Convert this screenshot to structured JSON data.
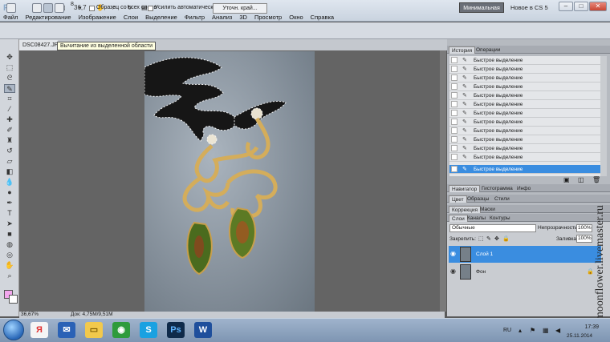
{
  "app": {
    "logo": "Ps",
    "zoom": "36,7",
    "workspace": "Минимальная",
    "whats_new": "Новое в CS 5",
    "window_buttons": [
      "–",
      "□",
      "✕"
    ]
  },
  "menu": [
    "Файл",
    "Редактирование",
    "Изображение",
    "Слои",
    "Выделение",
    "Фильтр",
    "Анализ",
    "3D",
    "Просмотр",
    "Окно",
    "Справка"
  ],
  "options": {
    "brush_size": "8",
    "sample_all_layers": "Образец со всех слоев",
    "auto_enhance": "Усилить автоматически",
    "refine_edge": "Уточн. край..."
  },
  "document": {
    "tab_name": "DSC08427.JPG",
    "tooltip": "Вычитание из выделенной области",
    "zoom_status": "36,67%",
    "doc_status": "Док: 4,75M/9,51M"
  },
  "panels": {
    "history_tabs": [
      "История",
      "Операции"
    ],
    "history_items": [
      "Быстрое выделение",
      "Быстрое выделение",
      "Быстрое выделение",
      "Быстрое выделение",
      "Быстрое выделение",
      "Быстрое выделение",
      "Быстрое выделение",
      "Быстрое выделение",
      "Быстрое выделение",
      "Быстрое выделение",
      "Быстрое выделение",
      "Быстрое выделение",
      "Быстрое выделение"
    ],
    "nav_tabs": [
      "Навигатор",
      "Гистограмма",
      "Инфо"
    ],
    "color_tabs": [
      "Цвет",
      "Образцы",
      "Стили"
    ],
    "adjust_tabs": [
      "Коррекция",
      "Маски"
    ],
    "layers_tabs": [
      "Слои",
      "Каналы",
      "Контуры"
    ],
    "blend_mode": "Обычные",
    "opacity_label": "Непрозрачность:",
    "opacity": "100%",
    "lock_label": "Закрепить:",
    "fill_label": "Заливка:",
    "fill": "100%",
    "layers": [
      "Слой 1",
      "Фон"
    ]
  },
  "watermark": "moonflower.livemaster.ru",
  "taskbar": {
    "lang": "RU",
    "time": "17:39",
    "date": "25.11.2014"
  }
}
